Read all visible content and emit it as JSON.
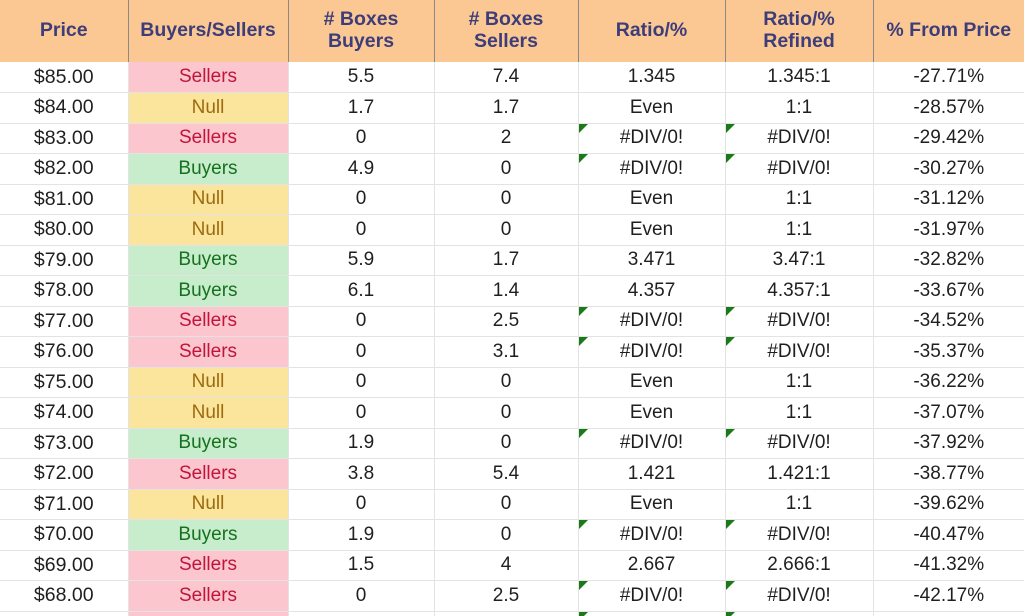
{
  "spreadsheet": {
    "title": "Price Ladder Buyers Sellers Ratio Table",
    "header_bg": "#fbc893",
    "header_fg": "#3d3d7a",
    "buyers_bg": "#c7edcd",
    "buyers_fg": "#16711e",
    "sellers_bg": "#fbc6ce",
    "sellers_fg": "#c0143c",
    "null_bg": "#fbe49b",
    "null_fg": "#9c6b10",
    "error_flag_color": "#1a7a1a"
  },
  "columns": [
    {
      "key": "price",
      "label": "Price"
    },
    {
      "key": "buyers_sellers",
      "label": "Buyers/Sellers"
    },
    {
      "key": "boxes_buyers",
      "label": "# Boxes\nBuyers"
    },
    {
      "key": "boxes_sellers",
      "label": "# Boxes\nSellers"
    },
    {
      "key": "ratio",
      "label": "Ratio/%"
    },
    {
      "key": "ratio_refined",
      "label": "Ratio/%\nRefined"
    },
    {
      "key": "pct_from_price",
      "label": "% From Price"
    }
  ],
  "rows": [
    {
      "price": "$85.00",
      "status": "Sellers",
      "status_kind": "sellers",
      "boxes_buyers": "5.5",
      "boxes_sellers": "7.4",
      "ratio": "1.345",
      "ratio_err": false,
      "ratio_refined": "1.345:1",
      "refined_err": false,
      "pct_from_price": "-27.71%"
    },
    {
      "price": "$84.00",
      "status": "Null",
      "status_kind": "null",
      "boxes_buyers": "1.7",
      "boxes_sellers": "1.7",
      "ratio": "Even",
      "ratio_err": false,
      "ratio_refined": "1:1",
      "refined_err": false,
      "pct_from_price": "-28.57%"
    },
    {
      "price": "$83.00",
      "status": "Sellers",
      "status_kind": "sellers",
      "boxes_buyers": "0",
      "boxes_sellers": "2",
      "ratio": "#DIV/0!",
      "ratio_err": true,
      "ratio_refined": "#DIV/0!",
      "refined_err": true,
      "pct_from_price": "-29.42%"
    },
    {
      "price": "$82.00",
      "status": "Buyers",
      "status_kind": "buyers",
      "boxes_buyers": "4.9",
      "boxes_sellers": "0",
      "ratio": "#DIV/0!",
      "ratio_err": true,
      "ratio_refined": "#DIV/0!",
      "refined_err": true,
      "pct_from_price": "-30.27%"
    },
    {
      "price": "$81.00",
      "status": "Null",
      "status_kind": "null",
      "boxes_buyers": "0",
      "boxes_sellers": "0",
      "ratio": "Even",
      "ratio_err": false,
      "ratio_refined": "1:1",
      "refined_err": false,
      "pct_from_price": "-31.12%"
    },
    {
      "price": "$80.00",
      "status": "Null",
      "status_kind": "null",
      "boxes_buyers": "0",
      "boxes_sellers": "0",
      "ratio": "Even",
      "ratio_err": false,
      "ratio_refined": "1:1",
      "refined_err": false,
      "pct_from_price": "-31.97%"
    },
    {
      "price": "$79.00",
      "status": "Buyers",
      "status_kind": "buyers",
      "boxes_buyers": "5.9",
      "boxes_sellers": "1.7",
      "ratio": "3.471",
      "ratio_err": false,
      "ratio_refined": "3.47:1",
      "refined_err": false,
      "pct_from_price": "-32.82%"
    },
    {
      "price": "$78.00",
      "status": "Buyers",
      "status_kind": "buyers",
      "boxes_buyers": "6.1",
      "boxes_sellers": "1.4",
      "ratio": "4.357",
      "ratio_err": false,
      "ratio_refined": "4.357:1",
      "refined_err": false,
      "pct_from_price": "-33.67%"
    },
    {
      "price": "$77.00",
      "status": "Sellers",
      "status_kind": "sellers",
      "boxes_buyers": "0",
      "boxes_sellers": "2.5",
      "ratio": "#DIV/0!",
      "ratio_err": true,
      "ratio_refined": "#DIV/0!",
      "refined_err": true,
      "pct_from_price": "-34.52%"
    },
    {
      "price": "$76.00",
      "status": "Sellers",
      "status_kind": "sellers",
      "boxes_buyers": "0",
      "boxes_sellers": "3.1",
      "ratio": "#DIV/0!",
      "ratio_err": true,
      "ratio_refined": "#DIV/0!",
      "refined_err": true,
      "pct_from_price": "-35.37%"
    },
    {
      "price": "$75.00",
      "status": "Null",
      "status_kind": "null",
      "boxes_buyers": "0",
      "boxes_sellers": "0",
      "ratio": "Even",
      "ratio_err": false,
      "ratio_refined": "1:1",
      "refined_err": false,
      "pct_from_price": "-36.22%"
    },
    {
      "price": "$74.00",
      "status": "Null",
      "status_kind": "null",
      "boxes_buyers": "0",
      "boxes_sellers": "0",
      "ratio": "Even",
      "ratio_err": false,
      "ratio_refined": "1:1",
      "refined_err": false,
      "pct_from_price": "-37.07%"
    },
    {
      "price": "$73.00",
      "status": "Buyers",
      "status_kind": "buyers",
      "boxes_buyers": "1.9",
      "boxes_sellers": "0",
      "ratio": "#DIV/0!",
      "ratio_err": true,
      "ratio_refined": "#DIV/0!",
      "refined_err": true,
      "pct_from_price": "-37.92%"
    },
    {
      "price": "$72.00",
      "status": "Sellers",
      "status_kind": "sellers",
      "boxes_buyers": "3.8",
      "boxes_sellers": "5.4",
      "ratio": "1.421",
      "ratio_err": false,
      "ratio_refined": "1.421:1",
      "refined_err": false,
      "pct_from_price": "-38.77%"
    },
    {
      "price": "$71.00",
      "status": "Null",
      "status_kind": "null",
      "boxes_buyers": "0",
      "boxes_sellers": "0",
      "ratio": "Even",
      "ratio_err": false,
      "ratio_refined": "1:1",
      "refined_err": false,
      "pct_from_price": "-39.62%"
    },
    {
      "price": "$70.00",
      "status": "Buyers",
      "status_kind": "buyers",
      "boxes_buyers": "1.9",
      "boxes_sellers": "0",
      "ratio": "#DIV/0!",
      "ratio_err": true,
      "ratio_refined": "#DIV/0!",
      "refined_err": true,
      "pct_from_price": "-40.47%"
    },
    {
      "price": "$69.00",
      "status": "Sellers",
      "status_kind": "sellers",
      "boxes_buyers": "1.5",
      "boxes_sellers": "4",
      "ratio": "2.667",
      "ratio_err": false,
      "ratio_refined": "2.666:1",
      "refined_err": false,
      "pct_from_price": "-41.32%"
    },
    {
      "price": "$68.00",
      "status": "Sellers",
      "status_kind": "sellers",
      "boxes_buyers": "0",
      "boxes_sellers": "2.5",
      "ratio": "#DIV/0!",
      "ratio_err": true,
      "ratio_refined": "#DIV/0!",
      "refined_err": true,
      "pct_from_price": "-42.17%"
    }
  ],
  "partial_row": {
    "price": "",
    "status": "",
    "status_kind": "sellers",
    "boxes_buyers": "",
    "boxes_sellers": "",
    "ratio": "",
    "ratio_err": true,
    "ratio_refined": "",
    "refined_err": true,
    "pct_from_price": ""
  }
}
